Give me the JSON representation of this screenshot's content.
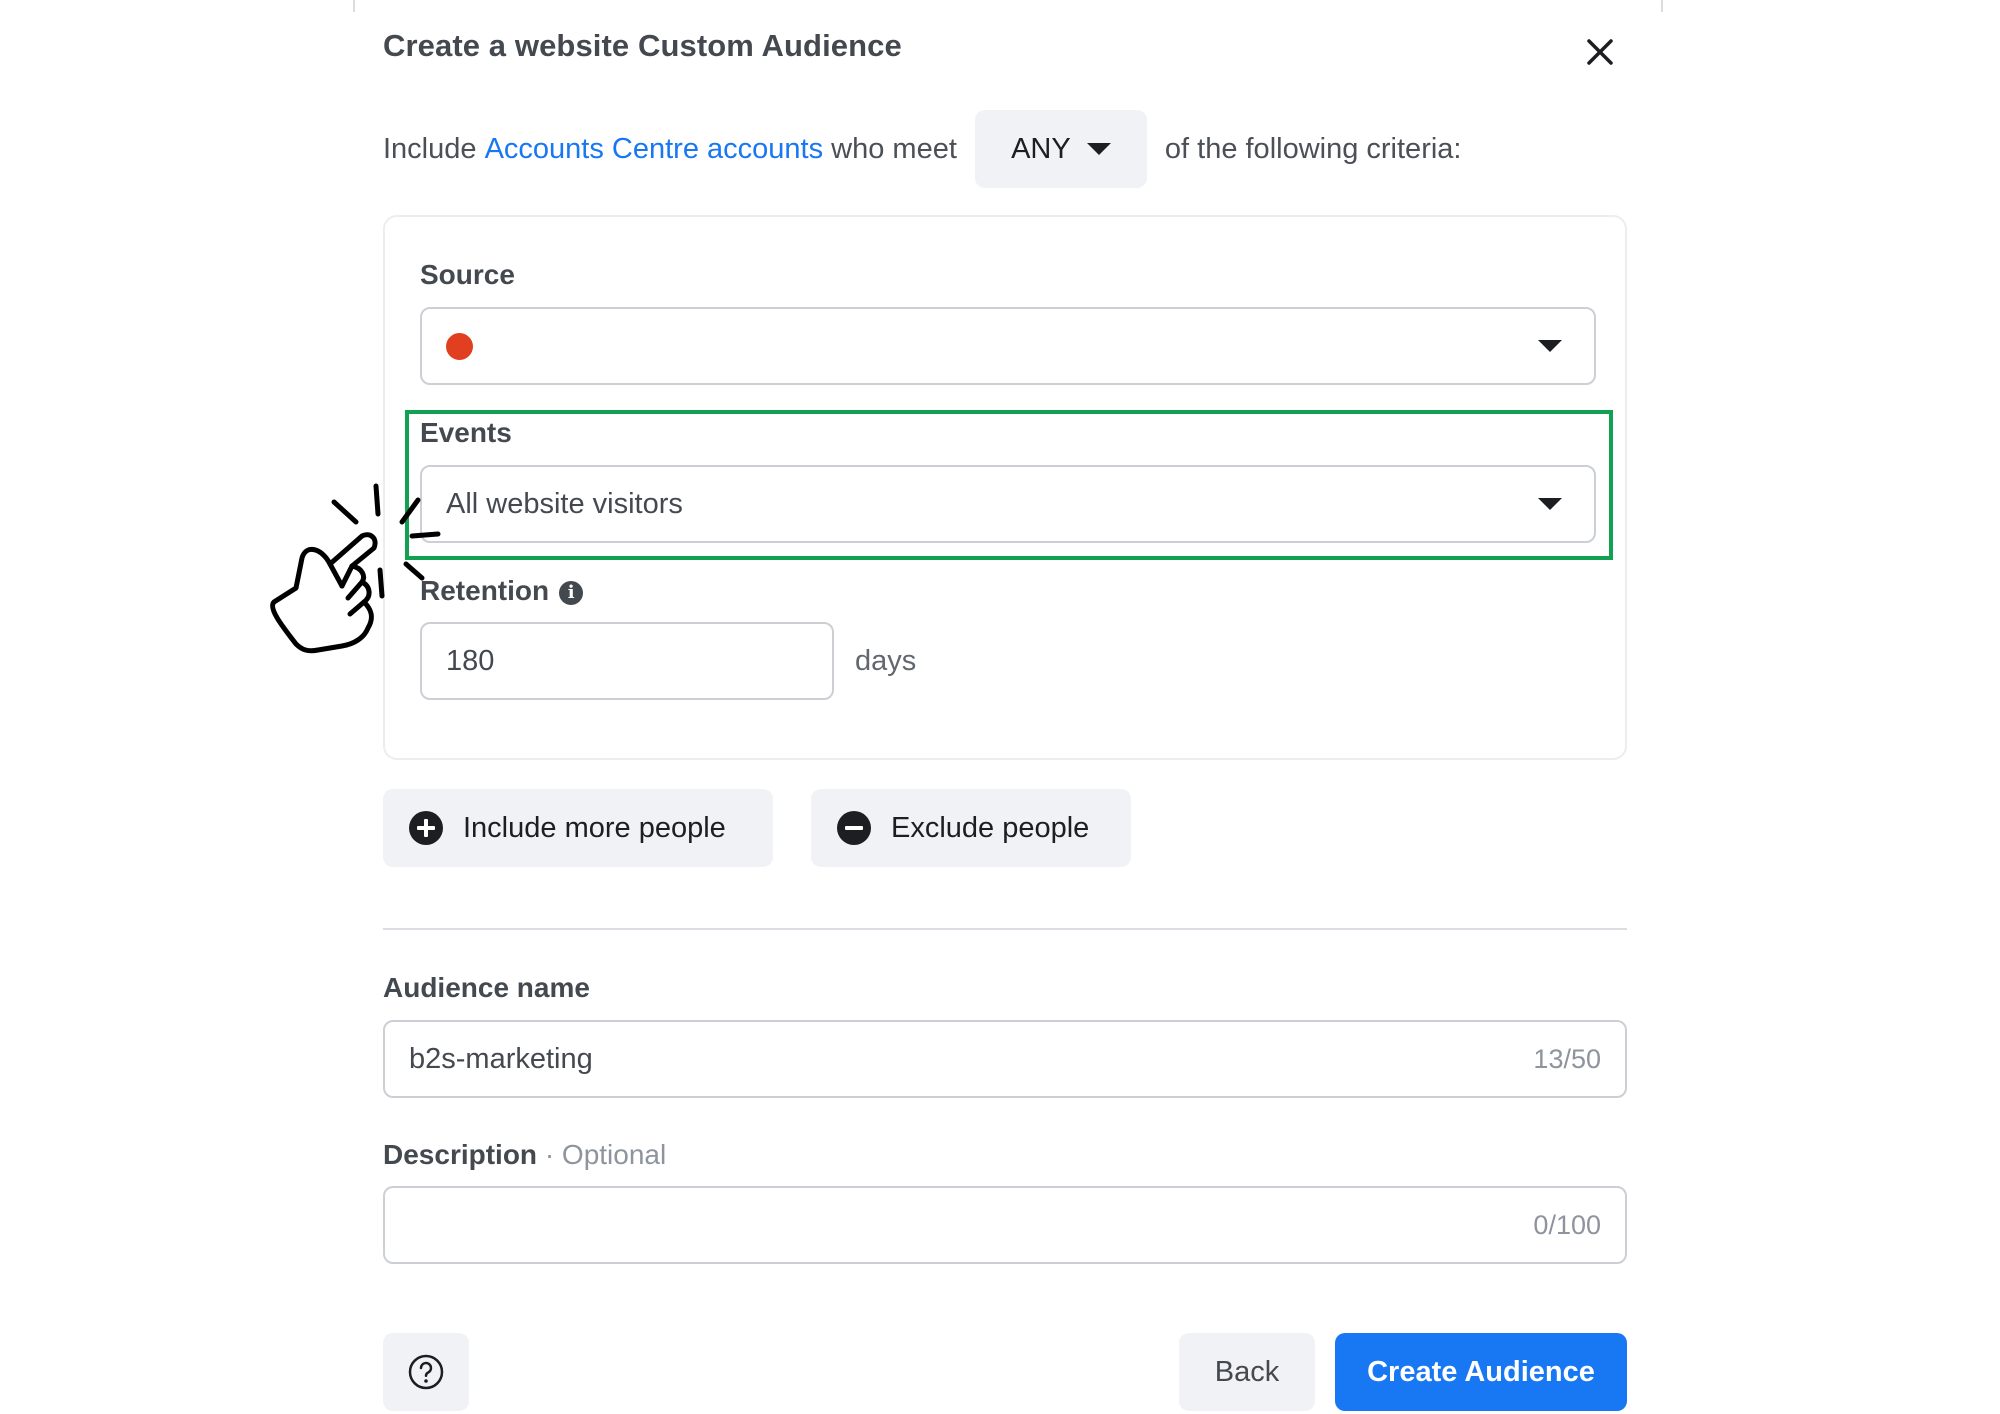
{
  "dialog": {
    "title": "Create a website Custom Audience",
    "close_icon": "close-icon"
  },
  "include_row": {
    "prefix": "Include",
    "link_text": "Accounts Centre accounts",
    "middle": "who meet",
    "match_value": "ANY",
    "suffix": "of the following criteria:"
  },
  "criteria": {
    "source_label": "Source",
    "source_status_color": "#e0401f",
    "events_label": "Events",
    "events_value": "All website visitors",
    "retention_label": "Retention",
    "retention_value": "180",
    "retention_unit": "days"
  },
  "actions": {
    "include_more": "Include more people",
    "exclude": "Exclude people"
  },
  "audience_name": {
    "label": "Audience name",
    "value": "b2s-marketing",
    "counter": "13/50"
  },
  "description": {
    "label": "Description",
    "optional": "· Optional",
    "value": "",
    "counter": "0/100"
  },
  "footer": {
    "back_label": "Back",
    "create_label": "Create Audience",
    "help_icon": "help-circle-icon"
  },
  "colors": {
    "primary": "#1877f2",
    "highlight": "#12a150",
    "secondary_bg": "#f0f2f5"
  },
  "annotation": {
    "icon": "hand-pointer-click-icon"
  }
}
